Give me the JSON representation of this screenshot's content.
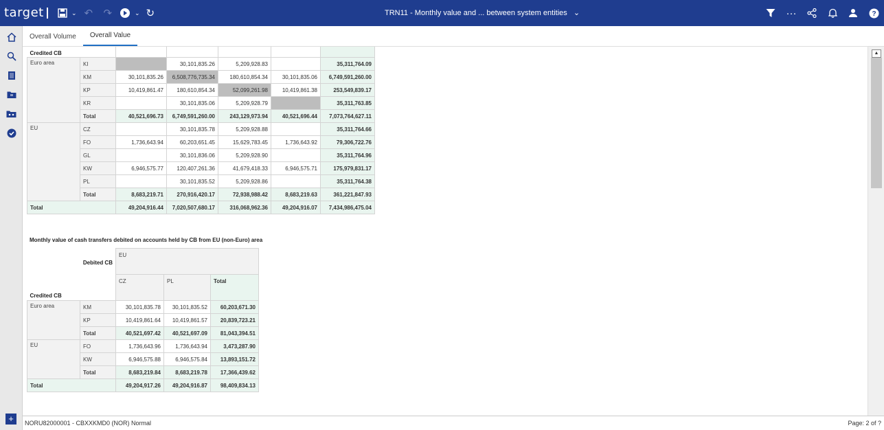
{
  "app": {
    "logo": "target",
    "title": "TRN11 - Monthly value and ... between system entities"
  },
  "tabs": [
    {
      "label": "Overall Volume"
    },
    {
      "label": "Overall Value"
    }
  ],
  "table1": {
    "corner_label": "Credited CB",
    "rows": [
      {
        "group": "Euro area",
        "code": "KI",
        "c1": "",
        "c2": "30,101,835.26",
        "c3": "5,209,928.83",
        "c4": "",
        "total": "35,311,764.09"
      },
      {
        "group": "",
        "code": "KM",
        "c1": "30,101,835.26",
        "c2": "6,508,776,735.34",
        "c3": "180,610,854.34",
        "c4": "30,101,835.06",
        "total": "6,749,591,260.00"
      },
      {
        "group": "",
        "code": "KP",
        "c1": "10,419,861.47",
        "c2": "180,610,854.34",
        "c3": "52,099,261.98",
        "c4": "10,419,861.38",
        "total": "253,549,839.17"
      },
      {
        "group": "",
        "code": "KR",
        "c1": "",
        "c2": "30,101,835.06",
        "c3": "5,209,928.79",
        "c4": "",
        "total": "35,311,763.85"
      },
      {
        "group": "",
        "code": "Total",
        "c1": "40,521,696.73",
        "c2": "6,749,591,260.00",
        "c3": "243,129,973.94",
        "c4": "40,521,696.44",
        "total": "7,073,764,627.11"
      },
      {
        "group": "EU",
        "code": "CZ",
        "c1": "",
        "c2": "30,101,835.78",
        "c3": "5,209,928.88",
        "c4": "",
        "total": "35,311,764.66"
      },
      {
        "group": "",
        "code": "FO",
        "c1": "1,736,643.94",
        "c2": "60,203,651.45",
        "c3": "15,629,783.45",
        "c4": "1,736,643.92",
        "total": "79,306,722.76"
      },
      {
        "group": "",
        "code": "GL",
        "c1": "",
        "c2": "30,101,836.06",
        "c3": "5,209,928.90",
        "c4": "",
        "total": "35,311,764.96"
      },
      {
        "group": "",
        "code": "KW",
        "c1": "6,946,575.77",
        "c2": "120,407,261.36",
        "c3": "41,679,418.33",
        "c4": "6,946,575.71",
        "total": "175,979,831.17"
      },
      {
        "group": "",
        "code": "PL",
        "c1": "",
        "c2": "30,101,835.52",
        "c3": "5,209,928.86",
        "c4": "",
        "total": "35,311,764.38"
      },
      {
        "group": "",
        "code": "Total",
        "c1": "8,683,219.71",
        "c2": "270,916,420.17",
        "c3": "72,938,988.42",
        "c4": "8,683,219.63",
        "total": "361,221,847.93"
      }
    ],
    "grand_total": {
      "label": "Total",
      "c1": "49,204,916.44",
      "c2": "7,020,507,680.17",
      "c3": "316,068,962.36",
      "c4": "49,204,916.07",
      "total": "7,434,986,475.04"
    }
  },
  "table2": {
    "title": "Monthly value of cash transfers debited on accounts held by CB from EU (non-Euro) area",
    "debited_label": "Debited CB",
    "group_header": "EU",
    "columns": [
      "CZ",
      "PL",
      "Total"
    ],
    "corner_label": "Credited CB",
    "rows": [
      {
        "group": "Euro area",
        "code": "KM",
        "c1": "30,101,835.78",
        "c2": "30,101,835.52",
        "total": "60,203,671.30"
      },
      {
        "group": "",
        "code": "KP",
        "c1": "10,419,861.64",
        "c2": "10,419,861.57",
        "total": "20,839,723.21"
      },
      {
        "group": "",
        "code": "Total",
        "c1": "40,521,697.42",
        "c2": "40,521,697.09",
        "total": "81,043,394.51"
      },
      {
        "group": "EU",
        "code": "FO",
        "c1": "1,736,643.96",
        "c2": "1,736,643.94",
        "total": "3,473,287.90"
      },
      {
        "group": "",
        "code": "KW",
        "c1": "6,946,575.88",
        "c2": "6,946,575.84",
        "total": "13,893,151.72"
      },
      {
        "group": "",
        "code": "Total",
        "c1": "8,683,219.84",
        "c2": "8,683,219.78",
        "total": "17,366,439.62"
      }
    ],
    "grand_total": {
      "label": "Total",
      "c1": "49,204,917.26",
      "c2": "49,204,916.87",
      "total": "98,409,834.13"
    }
  },
  "status": {
    "left": "NORU82000001 - CBXXKMD0 (NOR) Normal",
    "right": "Page: 2 of ?"
  },
  "icons": {
    "accent": "#1f3d8f"
  }
}
